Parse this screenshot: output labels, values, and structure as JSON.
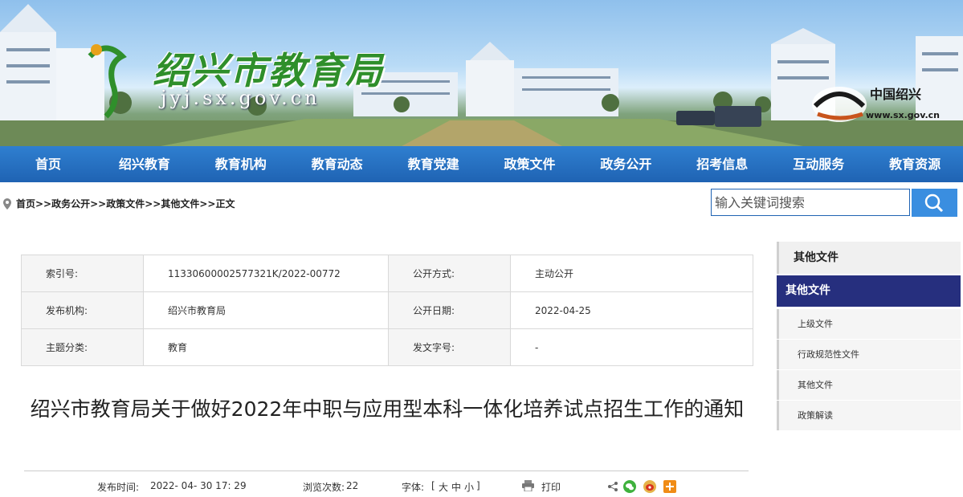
{
  "header": {
    "logo_title": "绍兴市教育局",
    "logo_domain": "jyj.sx.gov.cn",
    "partner_name": "中国绍兴",
    "partner_url": "www.sx.gov.cn"
  },
  "nav": {
    "items": [
      "首页",
      "绍兴教育",
      "教育机构",
      "教育动态",
      "教育党建",
      "政策文件",
      "政务公开",
      "招考信息",
      "互动服务",
      "教育资源"
    ]
  },
  "breadcrumb": {
    "text": "首页>>政务公开>>政策文件>>其他文件>>正文"
  },
  "search": {
    "placeholder": "输入关键词搜索"
  },
  "info_table": {
    "index_label": "索引号:",
    "index_value": "11330600002577321K/2022-00772",
    "open_mode_label": "公开方式:",
    "open_mode_value": "主动公开",
    "issuer_label": "发布机构:",
    "issuer_value": "绍兴市教育局",
    "open_date_label": "公开日期:",
    "open_date_value": "2022-04-25",
    "topic_label": "主题分类:",
    "topic_value": "教育",
    "doc_no_label": "发文字号:",
    "doc_no_value": "-"
  },
  "article": {
    "title": "绍兴市教育局关于做好2022年中职与应用型本科一体化培养试点招生工作的通知",
    "publish_time_label": "发布时间:",
    "publish_time_value": "2022- 04- 30 17: 29",
    "views_label": "浏览次数:",
    "views_value": "22",
    "font_label": "字体:",
    "font_open": "[",
    "font_large": "大",
    "font_medium": "中",
    "font_small": "小",
    "font_close": "]",
    "print_label": "打印"
  },
  "sidebar": {
    "header": "其他文件",
    "active": "其他文件",
    "items": [
      "上级文件",
      "行政规范性文件",
      "其他文件",
      "政策解读"
    ]
  },
  "colors": {
    "nav_blue": "#1f63b3",
    "sidebar_active": "#262f7e",
    "logo_green": "#2f8f2b"
  }
}
